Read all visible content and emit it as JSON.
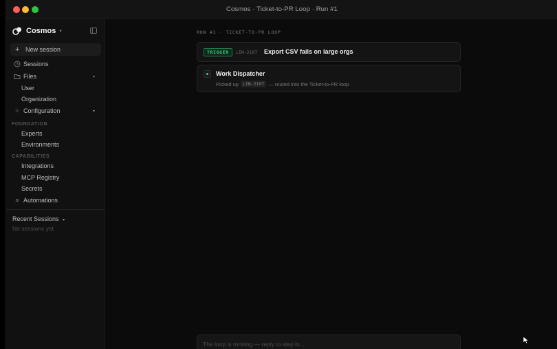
{
  "window": {
    "title": "Cosmos · Ticket-to-PR Loop · Run #1"
  },
  "brand": {
    "name": "Cosmos",
    "caret_icon": "chevron-down-icon"
  },
  "sidebar": {
    "new_session_label": "New session",
    "items": [
      {
        "label": "Sessions",
        "icon": "clock-icon"
      },
      {
        "label": "Files",
        "icon": "folder-icon",
        "expandable": true
      },
      {
        "label": "Configuration",
        "icon": "sparkle-icon",
        "expandable": true
      },
      {
        "label": "Automations",
        "icon": "list-icon"
      }
    ],
    "files_children": [
      "User",
      "Organization"
    ],
    "sections": {
      "foundation": {
        "label": "FOUNDATION",
        "items": [
          "Experts",
          "Environments"
        ]
      },
      "capabilities": {
        "label": "CAPABILITIES",
        "items": [
          "Integrations",
          "MCP Registry",
          "Secrets"
        ]
      }
    },
    "recent": {
      "title": "Recent Sessions",
      "empty": "No sessions yet"
    }
  },
  "main": {
    "run_label": "RUN #1 · TICKET-TO-PR LOOP",
    "trigger": {
      "badge": "TRIGGER",
      "ticket": "LIN-2107",
      "title": "Export CSV fails on large orgs"
    },
    "dispatcher": {
      "title": "Work Dispatcher",
      "prefix": "Picked up",
      "ticket": "LIN-2107",
      "suffix": "— routed into the Ticket-to-PR loop"
    },
    "composer": {
      "placeholder": "The loop is running — reply to step in..."
    }
  },
  "colors": {
    "accent_green": "#3fd07f",
    "background": "#0b0b0b",
    "sidebar": "#111111"
  }
}
